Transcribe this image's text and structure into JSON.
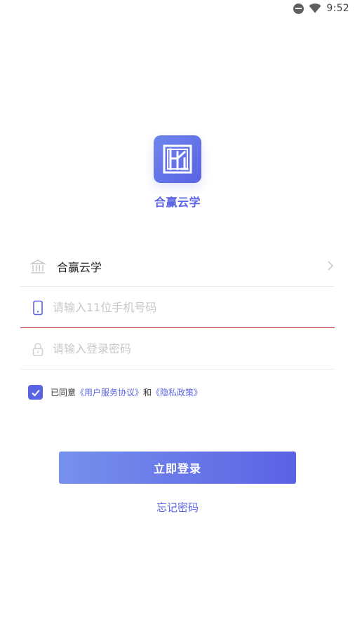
{
  "status_bar": {
    "time": "9:52",
    "icons": [
      "do-not-disturb-icon",
      "wifi-icon"
    ]
  },
  "app": {
    "name": "合赢云学",
    "brand_color": "#5a63e4"
  },
  "form": {
    "organization": {
      "icon": "bank-icon",
      "value": "合赢云学"
    },
    "phone": {
      "icon": "phone-icon",
      "placeholder": "请输入11位手机号码"
    },
    "password": {
      "icon": "lock-icon",
      "placeholder": "请输入登录密码"
    }
  },
  "agreement": {
    "checked": true,
    "prefix": "已同意",
    "terms_link": "《用户服务协议》",
    "conjunction": "和",
    "privacy_link": "《隐私政策》"
  },
  "actions": {
    "login_label": "立即登录",
    "forgot_label": "忘记密码"
  }
}
